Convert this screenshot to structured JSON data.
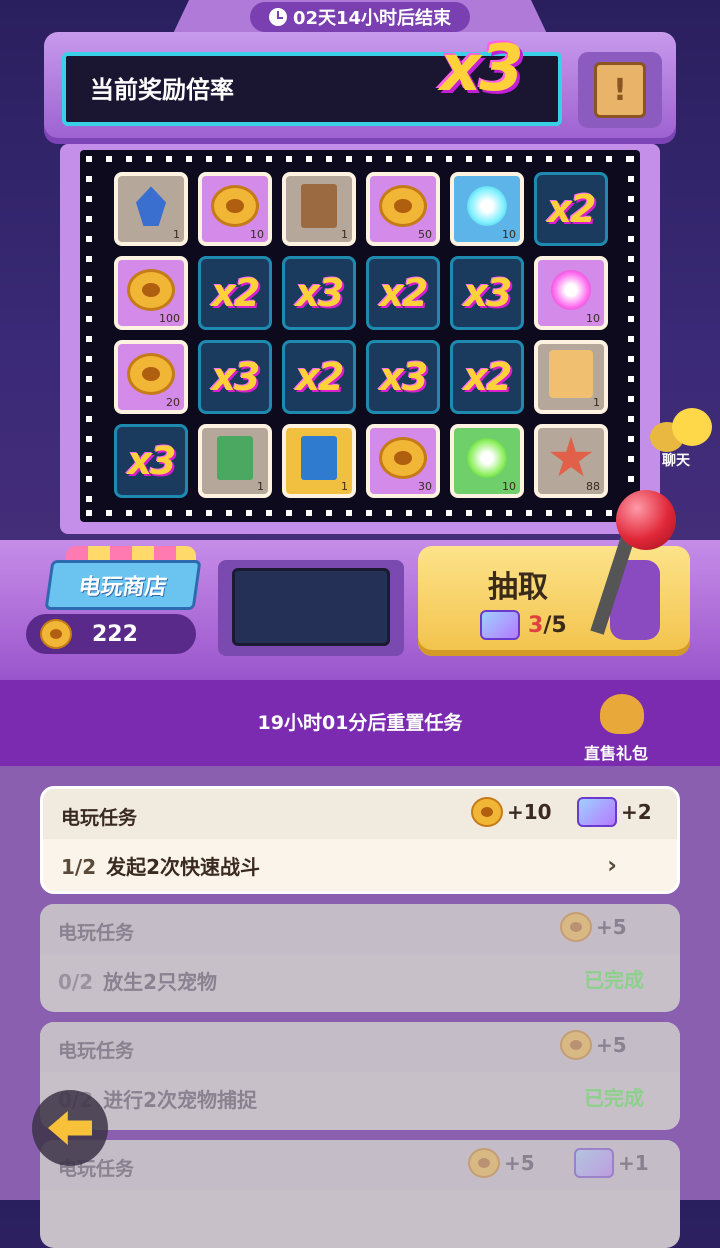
{
  "timer": {
    "text": "02天14小时后结束"
  },
  "ticker": {
    "label": "当前奖励倍率",
    "multiplier": "x3"
  },
  "board": {
    "tiles": [
      {
        "type": "item",
        "icon": "crystal-icon",
        "color": "gray",
        "count": "1"
      },
      {
        "type": "item",
        "icon": "paw-coin-icon",
        "color": "pink",
        "count": "10"
      },
      {
        "type": "item",
        "icon": "ticket-icon",
        "color": "gray",
        "count": "1"
      },
      {
        "type": "item",
        "icon": "paw-coin-icon",
        "color": "pink",
        "count": "50"
      },
      {
        "type": "item",
        "icon": "blue-essence-icon",
        "color": "blue",
        "count": "10"
      },
      {
        "type": "mult",
        "label": "x2"
      },
      {
        "type": "item",
        "icon": "paw-coin-icon",
        "color": "pink",
        "count": "100"
      },
      {
        "type": "mult",
        "label": "x2"
      },
      {
        "type": "mult",
        "label": "x3"
      },
      {
        "type": "mult",
        "label": "x2"
      },
      {
        "type": "mult",
        "label": "x3"
      },
      {
        "type": "item",
        "icon": "pink-essence-icon",
        "color": "pink",
        "count": "10"
      },
      {
        "type": "item",
        "icon": "paw-coin-icon",
        "color": "pink",
        "count": "20"
      },
      {
        "type": "mult",
        "label": "x3"
      },
      {
        "type": "mult",
        "label": "x2"
      },
      {
        "type": "mult",
        "label": "x3"
      },
      {
        "type": "mult",
        "label": "x2"
      },
      {
        "type": "item",
        "icon": "map-scroll-icon",
        "color": "gray",
        "count": "1"
      },
      {
        "type": "mult",
        "label": "x3"
      },
      {
        "type": "item",
        "icon": "green-ticket-icon",
        "color": "gray",
        "count": "1"
      },
      {
        "type": "item",
        "icon": "blue-ticket-icon",
        "color": "yellow",
        "count": "1"
      },
      {
        "type": "item",
        "icon": "paw-coin-icon",
        "color": "pink",
        "count": "30"
      },
      {
        "type": "item",
        "icon": "green-essence-icon",
        "color": "green",
        "count": "10"
      },
      {
        "type": "item",
        "icon": "starfish-icon",
        "color": "gray",
        "count": "88"
      }
    ]
  },
  "shop": {
    "label": "电玩商店",
    "coins": "222"
  },
  "draw": {
    "label": "抽取",
    "current": "3",
    "total": "/5"
  },
  "chat": {
    "label": "聊天"
  },
  "tasks_header": {
    "reset_text": "19小时01分后重置任务",
    "gift_label": "直售礼包"
  },
  "tasks": [
    {
      "title": "电玩任务",
      "progress": "1/2",
      "desc": "发起2次快速战斗",
      "coin_reward": "+10",
      "gem_reward": "+2",
      "state": "active",
      "chevron": "›"
    },
    {
      "title": "电玩任务",
      "progress": "0/2",
      "desc": "放生2只宠物",
      "coin_reward": "+5",
      "state": "done",
      "done_label": "已完成"
    },
    {
      "title": "电玩任务",
      "progress": "0/2",
      "desc": "进行2次宠物捕捉",
      "coin_reward": "+5",
      "state": "done",
      "done_label": "已完成"
    },
    {
      "title": "电玩任务",
      "coin_reward": "+5",
      "gem_reward": "+1",
      "state": "done"
    }
  ],
  "colors": {
    "accent": "#ffd23a",
    "panel": "#7a2bb0",
    "ticker_border": "#3ad0e8"
  }
}
